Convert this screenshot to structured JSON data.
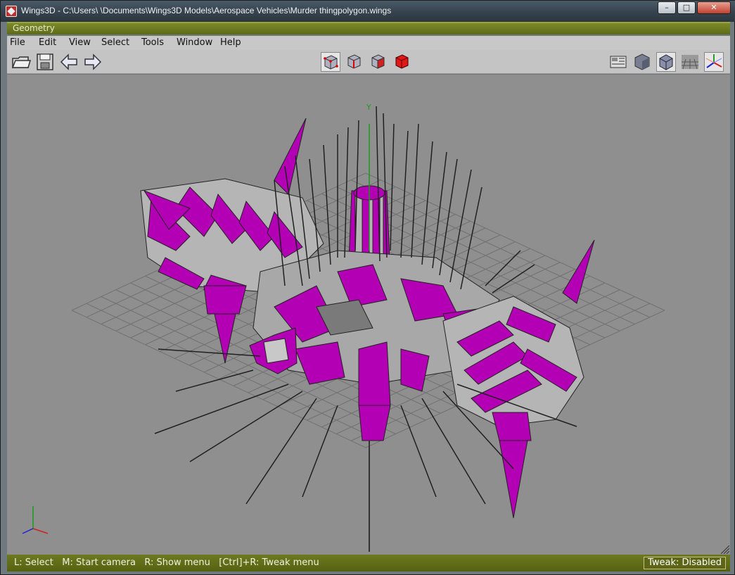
{
  "window": {
    "title": "Wings3D - C:\\Users\\ \\Documents\\Wings3D Models\\Aerospace Vehicles\\Murder thingpolygon.wings",
    "minimize_label": "–",
    "maximize_label": "□",
    "close_label": "✕"
  },
  "geometry": {
    "title": "Geometry"
  },
  "menu": {
    "items": [
      "File",
      "Edit",
      "View",
      "Select",
      "Tools",
      "Window",
      "Help"
    ]
  },
  "toolbar": {
    "left_icons": [
      "open-folder-icon",
      "save-icon",
      "undo-arrow-icon",
      "redo-arrow-icon"
    ],
    "selection_modes": [
      "vertex-mode",
      "edge-mode",
      "face-mode",
      "body-mode"
    ],
    "right_icons": [
      "workmode-icon",
      "smooth-shading-icon",
      "flat-shading-icon",
      "groundplane-icon",
      "axes-icon"
    ]
  },
  "viewport": {
    "axis_y_label": "Y",
    "mesh_color": "#b400b4",
    "grid_color": "#6e6e6e",
    "background": "#8f8f8f"
  },
  "status": {
    "hint": "L: Select   M: Start camera   R: Show menu   [Ctrl]+R: Tweak menu",
    "tweak": "Tweak: Disabled"
  }
}
